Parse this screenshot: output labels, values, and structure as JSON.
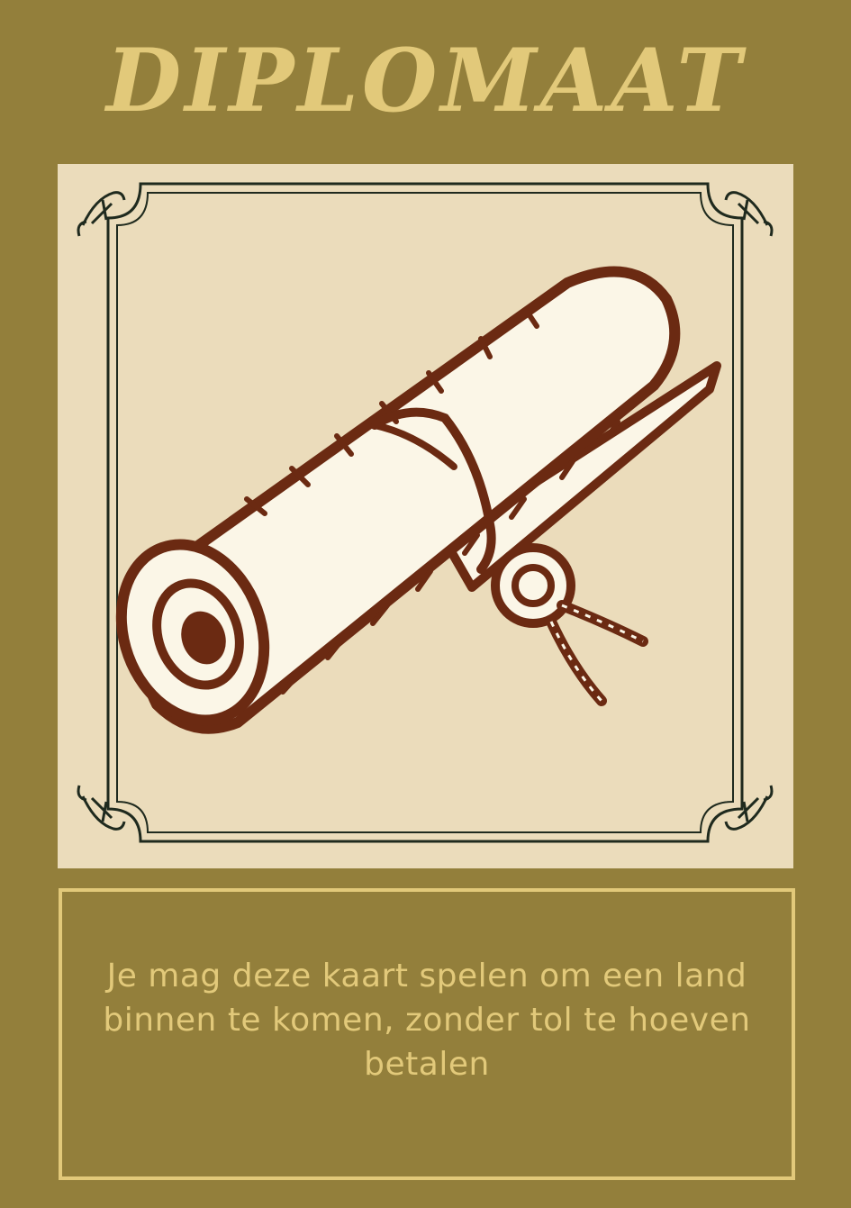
{
  "card": {
    "title": "DIPLOMAAT",
    "illustration": "rolled-diploma-scroll-with-wax-seal",
    "description": "Je mag deze kaart spelen om een land binnen te komen, zonder tol te hoeven betalen"
  },
  "colors": {
    "background": "#937f3b",
    "accent": "#e2c97a",
    "panel": "#ebdcbb",
    "frame": "#1f2a1e",
    "scroll_outline": "#6b2a12",
    "scroll_paper": "#fbf6e7"
  }
}
